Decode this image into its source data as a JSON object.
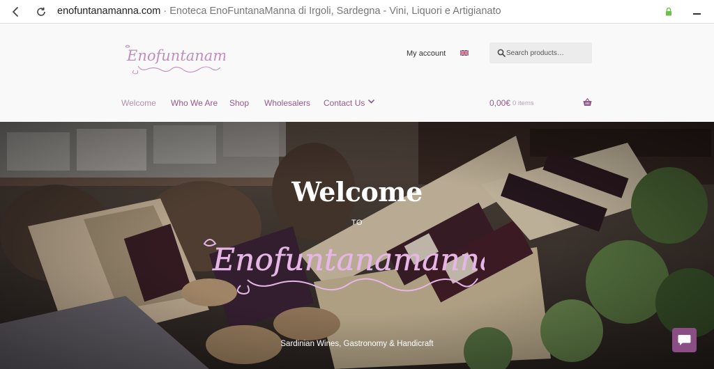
{
  "browser": {
    "url_domain": "enofuntanamanna.com",
    "url_separator": " · ",
    "page_title": "Enoteca EnoFuntanaManna di Irgoli, Sardegna - Vini, Liquori e Artigianato",
    "icons": [
      "back-arrow-icon",
      "reload-icon",
      "lock-icon",
      "minimize-icon"
    ]
  },
  "header": {
    "logo_text": "Enofuntanamanna",
    "my_account": "My account",
    "language_flag": "uk-flag-icon",
    "search_placeholder": "Search products…"
  },
  "nav": {
    "items": [
      {
        "label": "Welcome",
        "active": true
      },
      {
        "label": "Who We Are"
      },
      {
        "label": "Shop"
      },
      {
        "label": "Wholesalers"
      },
      {
        "label": "Contact Us",
        "has_dropdown": true
      }
    ]
  },
  "cart": {
    "total": "0,00€",
    "count": "0 items",
    "icon": "basket-icon"
  },
  "hero": {
    "title": "Welcome",
    "to": "TO",
    "logo_text": "Enofuntanamanna",
    "tagline": "Sardinian Wines, Gastronomy & Handicraft"
  },
  "chat": {
    "icon": "chat-bubble-icon"
  },
  "colors": {
    "brand_purple": "#96588a",
    "active_nav": "#b18fac",
    "logo_pink": "#d8a8d8",
    "chat_button": "#8a4d84",
    "header_bg": "#f9f9f9"
  }
}
